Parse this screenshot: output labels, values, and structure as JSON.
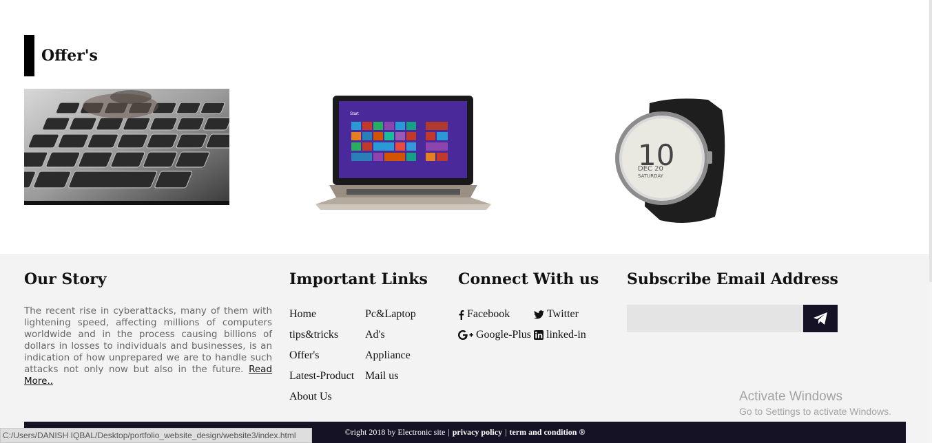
{
  "offers": {
    "title": "Offer's",
    "images": [
      {
        "name": "keyboard-offer-image"
      },
      {
        "name": "laptop-offer-image",
        "screen_label": "Start"
      },
      {
        "name": "smartwatch-offer-image",
        "time": "10",
        "date": "DEC 20",
        "day": "SATURDAY"
      }
    ]
  },
  "footer": {
    "story": {
      "title": "Our Story",
      "text": "The recent rise in cyberattacks, many of them with lightening speed, affecting millions of computers worldwide and in the process causing billions of dollars in losses to individuals and businesses, is an indication of how unprepared we are to handle such attacks not only now but also in the future.",
      "read_more": "Read More.."
    },
    "links": {
      "title": "Important Links",
      "items": [
        "Home",
        "Pc&Laptop",
        "tips&tricks",
        "Ad's",
        "Offer's",
        "Appliance",
        "Latest-Product",
        "Mail us",
        "About Us"
      ]
    },
    "connect": {
      "title": "Connect With us",
      "items": [
        {
          "label": "Facebook",
          "icon": "facebook-icon"
        },
        {
          "label": "Twitter",
          "icon": "twitter-icon"
        },
        {
          "label": "Google-Plus",
          "icon": "google-plus-icon"
        },
        {
          "label": "linked-in",
          "icon": "linkedin-icon"
        }
      ]
    },
    "subscribe": {
      "title": "Subscribe Email Address",
      "placeholder": "",
      "button_icon": "send-icon"
    },
    "bottom": {
      "copyright": "©right 2018 by Electronic site",
      "separator": "|",
      "privacy": "privacy policy",
      "terms": "term and condition ®"
    }
  },
  "os": {
    "watermark_title": "Activate Windows",
    "watermark_sub": "Go to Settings to activate Windows.",
    "status_url": "C:/Users/DANISH IQBAL/Desktop/portfolio_website_design/website3/index.html"
  },
  "colors": {
    "footer_bg": "#f3f3f3",
    "dark_bar": "#151226",
    "accent_black": "#000000"
  }
}
